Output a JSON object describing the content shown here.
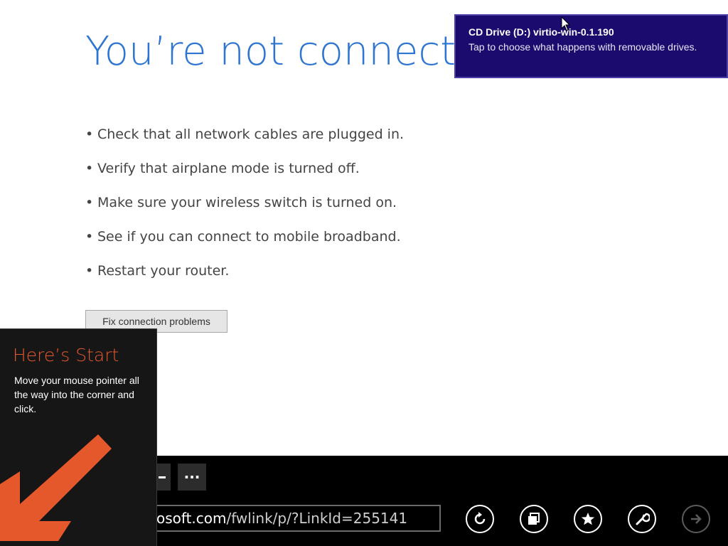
{
  "page": {
    "title": "You’re not connected",
    "checklist": [
      "Check that all network cables are plugged in.",
      "Verify that airplane mode is turned off.",
      "Make sure your wireless switch is turned on.",
      "See if you can connect to mobile broadband.",
      "Restart your router."
    ],
    "fix_button": "Fix connection problems"
  },
  "toast": {
    "title": "CD Drive (D:) virtio-win-0.1.190",
    "body": "Tap to choose what happens with removable drives."
  },
  "start_tip": {
    "title": "Here’s Start",
    "body": "Move your mouse pointer all the way into the corner and click."
  },
  "appbar": {
    "more_label": "···",
    "address_host": "osoft.com",
    "address_path": "/fwlink/p/?LinkId=255141",
    "buttons": [
      {
        "icon": "refresh-icon",
        "enabled": true
      },
      {
        "icon": "pin-icon",
        "enabled": true
      },
      {
        "icon": "favorite-star-icon",
        "enabled": true
      },
      {
        "icon": "page-tools-wrench-icon",
        "enabled": true
      },
      {
        "icon": "forward-arrow-icon",
        "enabled": false
      }
    ]
  },
  "colors": {
    "title_blue": "#2e75d1",
    "toast_bg": "#1c0b6e",
    "start_orange": "#e5582b",
    "appbar_bg": "#000000"
  }
}
